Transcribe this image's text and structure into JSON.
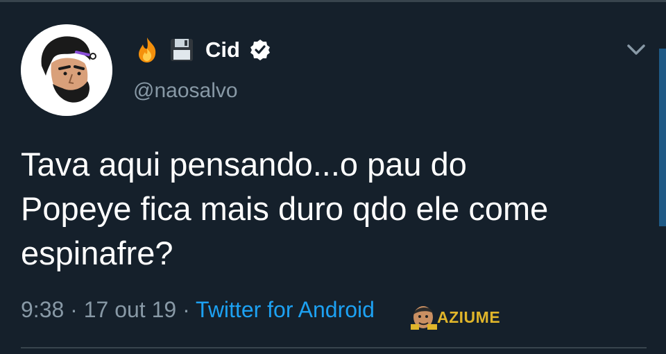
{
  "tweet": {
    "author": {
      "emojis": [
        "fire-emoji",
        "floppy-disk-emoji"
      ],
      "display_name": "Cid",
      "verified": true,
      "handle": "@naosalvo"
    },
    "text": "Tava aqui pensando...o pau do\nPopeye fica mais duro qdo ele come\nespinafre?",
    "time": "9:38",
    "separator": "·",
    "date": "17 out 19",
    "source": "Twitter for Android"
  },
  "watermark": {
    "text": "AZIUME",
    "face_letter": "Z"
  },
  "colors": {
    "background": "#15202b",
    "text": "#ffffff",
    "secondary": "#8899a6",
    "link": "#1da1f2",
    "watermark": "#e0b52a",
    "border": "#38444d"
  }
}
